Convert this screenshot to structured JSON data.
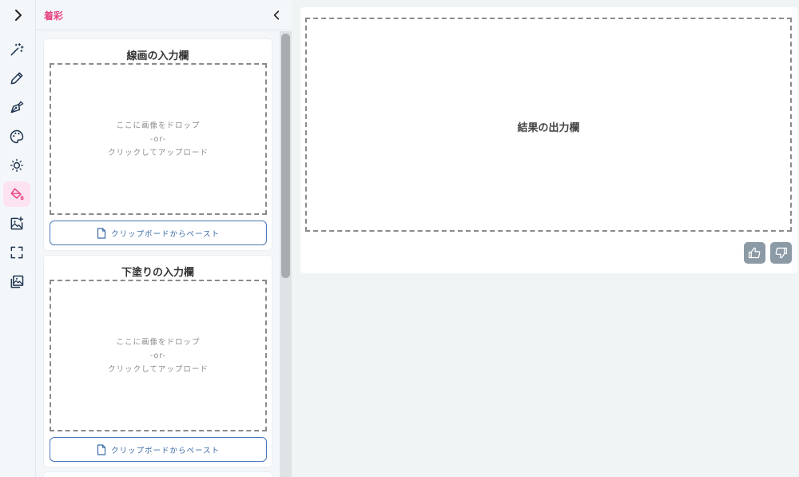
{
  "icons": {
    "rail_toggle": "chevron-right-icon",
    "rail": [
      "magic-wand-icon",
      "pencil-icon",
      "pen-nib-icon",
      "palette-icon",
      "sun-icon",
      "paint-bucket-icon",
      "image-plus-icon",
      "frame-corners-icon",
      "gallery-icon"
    ],
    "active_rail_index": 5,
    "collapse": "chevron-left-icon",
    "paste": "document-icon",
    "thumbs_up": "thumbs-up-icon",
    "thumbs_down": "thumbs-down-icon"
  },
  "colors": {
    "accent": "#e8447f",
    "active_bg": "#fde2ef",
    "button_blue": "#3b6aa8",
    "vote_bg": "#8c9aa6"
  },
  "panel": {
    "title": "着彩",
    "cards": [
      {
        "title": "線画の入力欄",
        "drop_line1": "ここに画像をドロップ",
        "drop_line2": "-or-",
        "drop_line3": "クリックしてアップロード",
        "paste_label": "クリップボードからペースト"
      },
      {
        "title": "下塗りの入力欄",
        "drop_line1": "ここに画像をドロップ",
        "drop_line2": "-or-",
        "drop_line3": "クリックしてアップロード",
        "paste_label": "クリップボードからペースト"
      }
    ]
  },
  "output": {
    "label": "結果の出力欄"
  }
}
